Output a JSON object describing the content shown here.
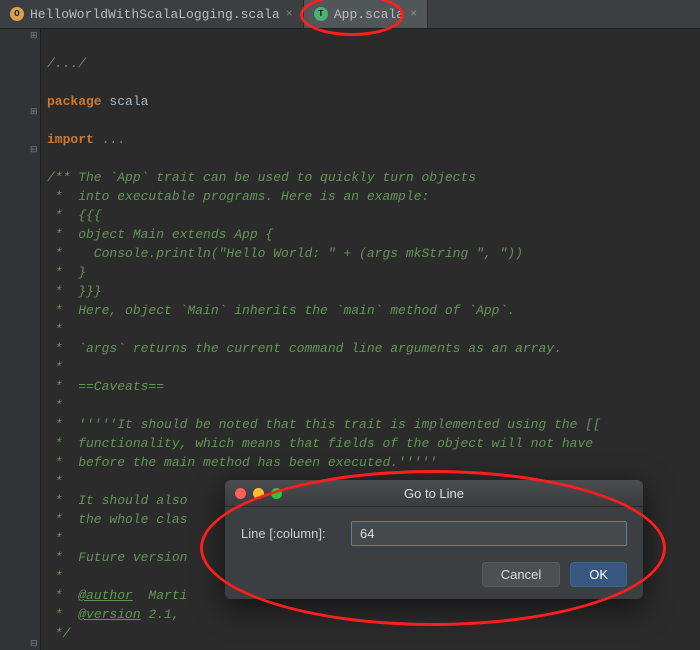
{
  "tabs": {
    "inactive": {
      "icon_letter": "O",
      "label": "HelloWorldWithScalaLogging.scala"
    },
    "active": {
      "icon_letter": "T",
      "label": "App.scala"
    }
  },
  "code": {
    "l1": "/.../",
    "l2_kw": "package",
    "l2_b": " scala",
    "l3_kw": "import",
    "l3_b": " ...",
    "c01": "/** The `App` trait can be used to quickly turn objects",
    "c02": " *  into executable programs. Here is an example:",
    "c03": " *  {{{",
    "c04": " *  object Main extends App {",
    "c05": " *    Console.println(\"Hello World: \" + (args mkString \", \"))",
    "c06": " *  }",
    "c07": " *  }}}",
    "c08": " *  Here, object `Main` inherits the `main` method of `App`.",
    "c09": " *",
    "c10": " *  `args` returns the current command line arguments as an array.",
    "c11": " *",
    "c12": " *  ==Caveats==",
    "c13": " *",
    "c14": " *  '''''It should be noted that this trait is implemented using the [[",
    "c15": " *  functionality, which means that fields of the object will not have ",
    "c16": " *  before the main method has been executed.'''''",
    "c17": " *",
    "c18": " *  It should also                                                 overri",
    "c19": " *  the whole clas",
    "c20": " *",
    "c21": " *  Future version                                                  it.",
    "c22": " *",
    "c23a": " *  ",
    "c23b": "@author",
    "c23c": "  Marti",
    "c24a": " *  ",
    "c24b": "@version",
    "c24c": " 2.1,",
    "c25": " */"
  },
  "dialog": {
    "title": "Go to Line",
    "field_label": "Line [:column]:",
    "value": "64",
    "cancel": "Cancel",
    "ok": "OK"
  }
}
